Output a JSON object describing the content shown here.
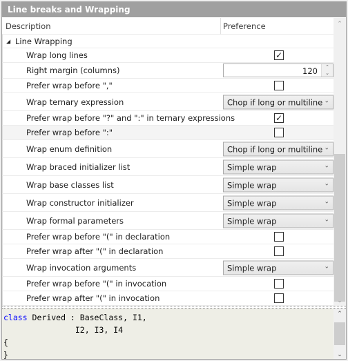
{
  "title": "Line breaks and Wrapping",
  "columns": {
    "description": "Description",
    "preference": "Preference"
  },
  "group": {
    "label": "Line Wrapping",
    "expanded": true
  },
  "rows": [
    {
      "label": "Wrap long lines",
      "type": "checkbox",
      "checked": true
    },
    {
      "label": "Right margin (columns)",
      "type": "spin",
      "value": "120"
    },
    {
      "label": "Prefer wrap before \",\"",
      "type": "checkbox",
      "checked": false
    },
    {
      "label": "Wrap ternary expression",
      "type": "combo",
      "value": "Chop if long or multiline"
    },
    {
      "label": "Prefer wrap before \"?\" and \":\" in ternary expressions",
      "type": "checkbox",
      "checked": true
    },
    {
      "label": "Prefer wrap before \":\"",
      "type": "checkbox",
      "checked": false,
      "selected": true
    },
    {
      "label": "Wrap enum definition",
      "type": "combo",
      "value": "Chop if long or multiline"
    },
    {
      "label": "Wrap braced initializer list",
      "type": "combo",
      "value": "Simple wrap"
    },
    {
      "label": "Wrap base classes list",
      "type": "combo",
      "value": "Simple wrap"
    },
    {
      "label": "Wrap constructor initializer",
      "type": "combo",
      "value": "Simple wrap"
    },
    {
      "label": "Wrap formal parameters",
      "type": "combo",
      "value": "Simple wrap"
    },
    {
      "label": "Prefer wrap before \"(\" in declaration",
      "type": "checkbox",
      "checked": false
    },
    {
      "label": "Prefer wrap after \"(\" in declaration",
      "type": "checkbox",
      "checked": false
    },
    {
      "label": "Wrap invocation arguments",
      "type": "combo",
      "value": "Simple wrap"
    },
    {
      "label": "Prefer wrap before \"(\" in invocation",
      "type": "checkbox",
      "checked": false
    },
    {
      "label": "Prefer wrap after \"(\" in invocation",
      "type": "checkbox",
      "checked": false
    }
  ],
  "preview": {
    "keyword": "class",
    "line1_rest": " Derived : BaseClass, I1,",
    "line2": "               I2, I3, I4",
    "line3": "{",
    "line4": "}"
  },
  "colors": {
    "title_bg": "#a0a0a0",
    "preview_bg": "#eeeee6",
    "keyword": "#0000ff"
  }
}
